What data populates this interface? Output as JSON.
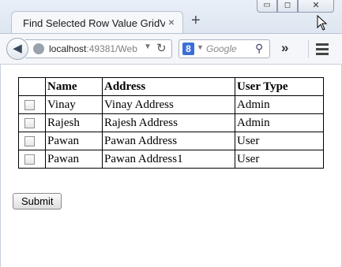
{
  "browser": {
    "tab_title": "Find Selected Row Value GridVi...",
    "tab_close": "×",
    "new_tab": "+",
    "window_buttons": {
      "minimize": "▭",
      "maximize": "◻",
      "close": "✕"
    },
    "url_host": "localhost",
    "url_path": ":49381/Web",
    "search_placeholder": "Google",
    "search_engine": "8",
    "overflow": "»",
    "icons": [
      "back-arrow-icon",
      "globe-icon",
      "reload-icon",
      "search-icon",
      "hamburger-menu-icon",
      "cursor-icon"
    ]
  },
  "grid": {
    "headers": [
      "",
      "Name",
      "Address",
      "User Type"
    ],
    "rows": [
      {
        "name": "Vinay",
        "address": "Vinay Address",
        "user_type": "Admin",
        "checked": false
      },
      {
        "name": "Rajesh",
        "address": "Rajesh Address",
        "user_type": "Admin",
        "checked": false
      },
      {
        "name": "Pawan",
        "address": "Pawan Address",
        "user_type": "User",
        "checked": false
      },
      {
        "name": "Pawan",
        "address": "Pawan Address1",
        "user_type": "User",
        "checked": false
      }
    ]
  },
  "form": {
    "submit_label": "Submit"
  }
}
